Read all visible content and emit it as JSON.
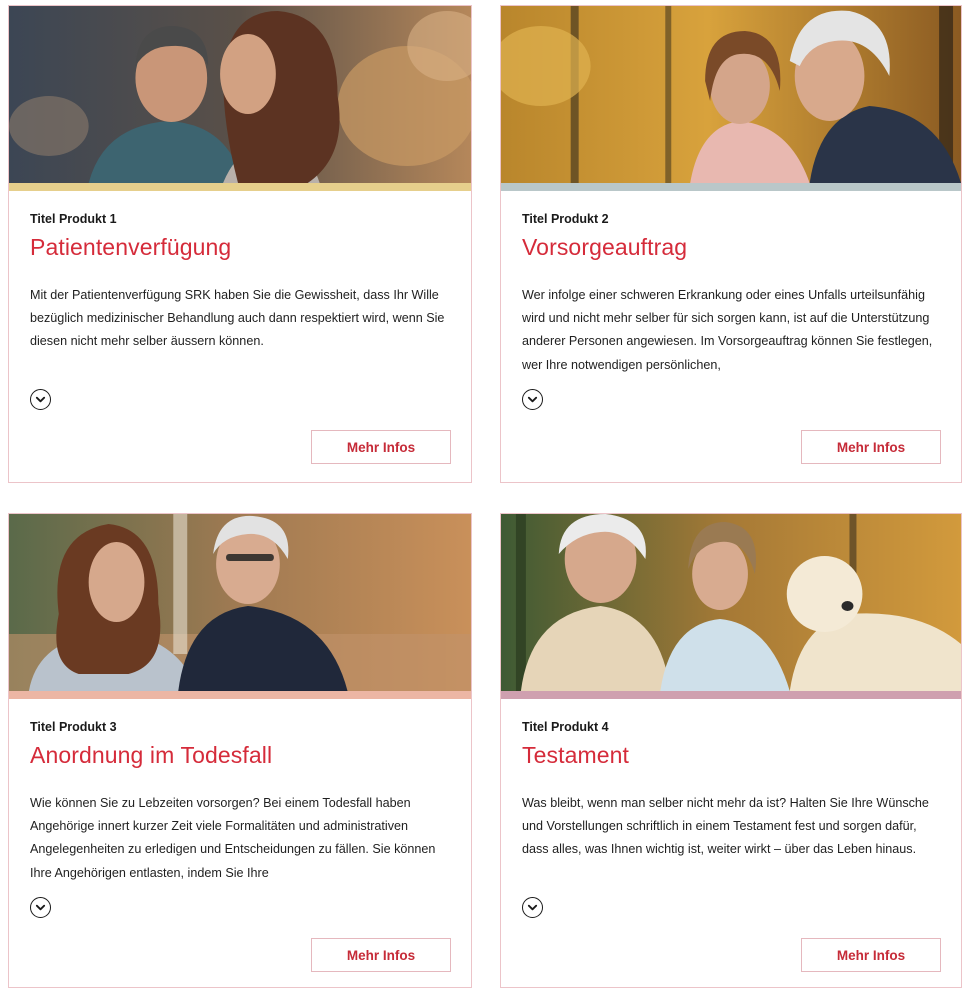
{
  "cards": [
    {
      "label": "Titel Produkt 1",
      "title": "Patientenverfügung",
      "text": "Mit der Patientenverfügung SRK haben Sie die Gewissheit, dass Ihr Wille bezüglich medizinischer Behandlung auch dann respek­tiert wird, wenn Sie diesen nicht mehr selber äussern können.",
      "button": "Mehr Infos",
      "expand_icon": "chevron-down-icon",
      "stripe_color": "#e6cf8c"
    },
    {
      "label": "Titel Produkt 2",
      "title": "Vorsorgeauftrag",
      "text": "Wer infolge einer schweren Erkrankung oder eines Unfalls urteils­unfähig wird und nicht mehr selber für sich sorgen kann, ist auf die Unterstützung anderer Personen angewiesen. Im Vorsorge­auftrag können Sie festlegen, wer Ihre notwendigen persönlichen,",
      "button": "Mehr Infos",
      "expand_icon": "chevron-down-icon",
      "stripe_color": "#b9c7c9"
    },
    {
      "label": "Titel Produkt 3",
      "title": "Anordnung im Todesfall",
      "text": "Wie können Sie zu Lebzeiten vorsorgen? Bei einem Todesfall ha­ben Angehörige innert kurzer Zeit viele Formalitäten und admi­nistrativen Angelegenheiten zu erledigen und Entscheidungen zu fällen. Sie können Ihre Angehörigen entlasten, indem Sie Ihre",
      "button": "Mehr Infos",
      "expand_icon": "chevron-down-icon",
      "stripe_color": "#ecb6a4"
    },
    {
      "label": "Titel Produkt 4",
      "title": "Testament",
      "text": "Was bleibt, wenn man selber nicht mehr da ist? Halten Sie Ihre Wünsche und Vorstellungen schriftlich in einem Testament fest und sorgen dafür, dass alles, was Ihnen wichtig ist, weiter wirkt – über das Leben hinaus.",
      "button": "Mehr Infos",
      "expand_icon": "chevron-down-icon",
      "stripe_color": "#cfa0af"
    }
  ],
  "colors": {
    "accent": "#d52b3a",
    "button_text": "#c62b38",
    "card_border": "#ecc4c9"
  }
}
